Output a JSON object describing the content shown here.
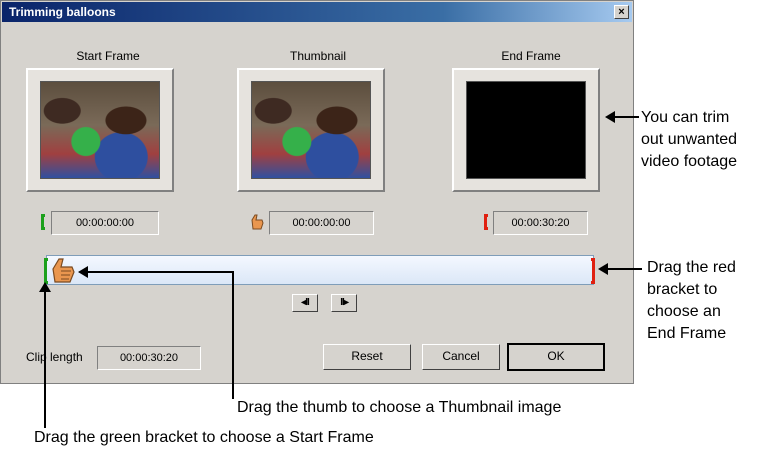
{
  "dialog": {
    "title": "Trimming balloons",
    "close_label": "×",
    "start_frame": {
      "label": "Start Frame",
      "time": "00:00:00:00"
    },
    "thumbnail": {
      "label": "Thumbnail",
      "time": "00:00:00:00"
    },
    "end_frame": {
      "label": "End Frame",
      "time": "00:00:30:20"
    },
    "step_back_label": "◂II",
    "step_fwd_label": "II▸",
    "clip_length": {
      "label": "Clip length",
      "value": "00:00:30:20"
    },
    "buttons": {
      "reset": "Reset",
      "cancel": "Cancel",
      "ok": "OK"
    }
  },
  "annotations": {
    "trim_lines": [
      "You can trim",
      "out unwanted",
      "video footage"
    ],
    "red_bracket_lines": [
      "Drag the red",
      "bracket to",
      "choose an",
      "End Frame"
    ],
    "thumb_note": "Drag the thumb to choose a Thumbnail image",
    "green_note": "Drag the green bracket to choose a Start Frame"
  }
}
